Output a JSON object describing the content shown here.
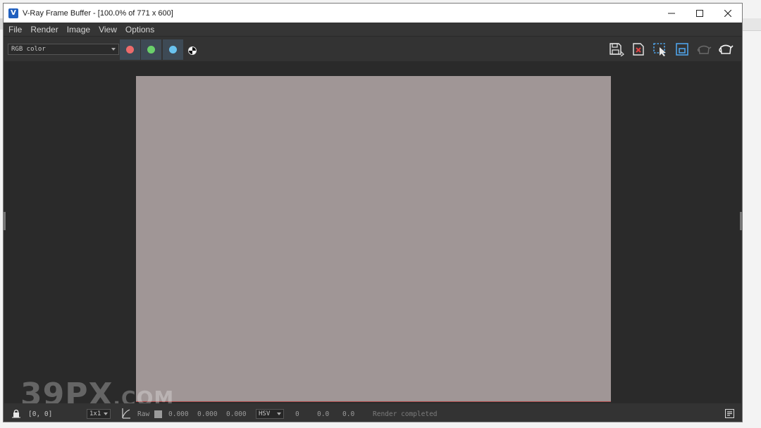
{
  "window": {
    "title": "V-Ray Frame Buffer - [100.0% of 771 x 600]",
    "app_icon_glyph": "V"
  },
  "menu": [
    "File",
    "Render",
    "Image",
    "View",
    "Options"
  ],
  "toolbar": {
    "channel": "RGB color",
    "channel_buttons": [
      {
        "name": "red-channel",
        "color": "#ec6b6b"
      },
      {
        "name": "green-channel",
        "color": "#6ad06a"
      },
      {
        "name": "blue-channel",
        "color": "#6ac3ef"
      }
    ],
    "right_icons": [
      "save-image-icon",
      "clear-image-icon",
      "region-render-icon",
      "link-to-vfb-icon",
      "render-last-icon",
      "render-teapot-icon"
    ]
  },
  "render": {
    "image_color": "#a09696"
  },
  "watermark": {
    "main": "39PX",
    "suffix": ".COM"
  },
  "status": {
    "coords": "[0, 0]",
    "sample_size": "1x1",
    "raw_label": "Raw",
    "rgb": [
      "0.000",
      "0.000",
      "0.000"
    ],
    "color_mode": "HSV",
    "hsv": [
      "0",
      "0.0",
      "0.0"
    ],
    "message": "Render completed"
  }
}
